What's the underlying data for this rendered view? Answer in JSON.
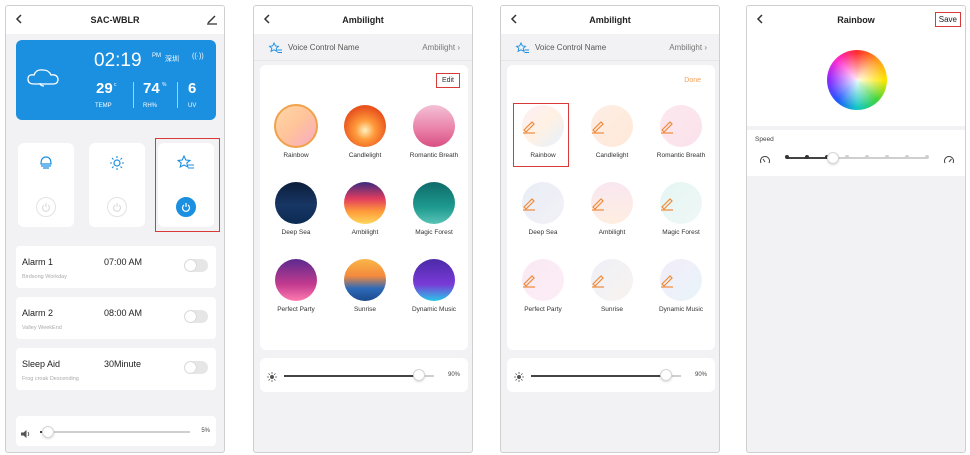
{
  "phone1": {
    "title": "SAC-WBLR",
    "weather": {
      "time": "02:19",
      "ampm": "PM",
      "city": "深圳",
      "temp": "29",
      "temp_unit": "c",
      "temp_label": "TEMP",
      "humidity": "74",
      "humidity_unit": "%",
      "humidity_label": "RH%",
      "uv": "6",
      "uv_label": "UV"
    },
    "alarms": [
      {
        "name": "Alarm 1",
        "time": "07:00 AM",
        "sub": "Birdsong Workday"
      },
      {
        "name": "Alarm 2",
        "time": "08:00 AM",
        "sub": "Valley WeekEnd"
      },
      {
        "name": "Sleep Aid",
        "time": "30Minute",
        "sub": "Frog croak Descending"
      }
    ],
    "volume": {
      "percent_label": "5%",
      "level": 0.05
    }
  },
  "phone2": {
    "title": "Ambilight",
    "voice_label": "Voice Control Name",
    "voice_value": "Ambilight",
    "edit_label": "Edit",
    "scenes": [
      "Rainbow",
      "Candlelight",
      "Romantic Breath",
      "Deep Sea",
      "Ambilight",
      "Magic Forest",
      "Perfect Party",
      "Sunrise",
      "Dynamic Music"
    ],
    "brightness": {
      "percent_label": "90%",
      "level": 0.9
    }
  },
  "phone3": {
    "title": "Ambilight",
    "voice_label": "Voice Control Name",
    "voice_value": "Ambilight",
    "done_label": "Done",
    "scenes": [
      "Rainbow",
      "Candlelight",
      "Romantic Breath",
      "Deep Sea",
      "Ambilight",
      "Magic Forest",
      "Perfect Party",
      "Sunrise",
      "Dynamic Music"
    ],
    "brightness": {
      "percent_label": "90%",
      "level": 0.9
    }
  },
  "phone4": {
    "title": "Rainbow",
    "save_label": "Save",
    "speed_label": "Speed",
    "speed_level": 0.33
  },
  "colors": {
    "accent_blue": "#1b8fe0",
    "highlight_red": "#d83a3a",
    "done_orange": "#f5a05a"
  }
}
